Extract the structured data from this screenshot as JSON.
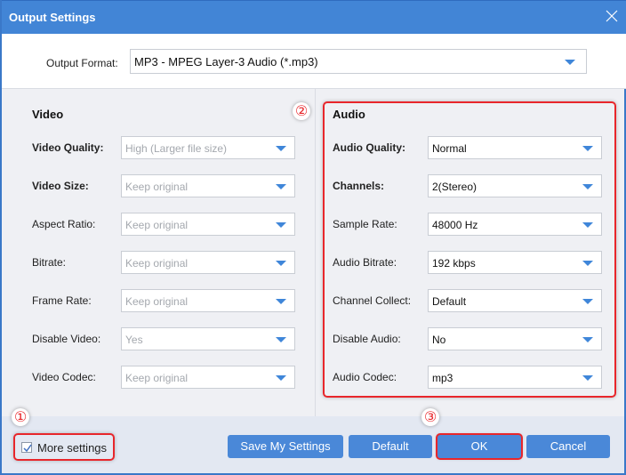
{
  "dialog": {
    "title": "Output Settings",
    "close_icon": "close-icon"
  },
  "output_format": {
    "label": "Output Format:",
    "value": "MP3 - MPEG Layer-3 Audio (*.mp3)"
  },
  "video": {
    "title": "Video",
    "fields": [
      {
        "label": "Video Quality:",
        "value": "High (Larger file size)",
        "bold": true,
        "disabled": true
      },
      {
        "label": "Video Size:",
        "value": "Keep original",
        "bold": true,
        "disabled": true
      },
      {
        "label": "Aspect Ratio:",
        "value": "Keep original",
        "bold": false,
        "disabled": true
      },
      {
        "label": "Bitrate:",
        "value": "Keep original",
        "bold": false,
        "disabled": true
      },
      {
        "label": "Frame Rate:",
        "value": "Keep original",
        "bold": false,
        "disabled": true
      },
      {
        "label": "Disable Video:",
        "value": "Yes",
        "bold": false,
        "disabled": true
      },
      {
        "label": "Video Codec:",
        "value": "Keep original",
        "bold": false,
        "disabled": true
      }
    ]
  },
  "audio": {
    "title": "Audio",
    "fields": [
      {
        "label": "Audio Quality:",
        "value": "Normal",
        "bold": true,
        "disabled": false
      },
      {
        "label": "Channels:",
        "value": "2(Stereo)",
        "bold": true,
        "disabled": false
      },
      {
        "label": "Sample Rate:",
        "value": "48000 Hz",
        "bold": false,
        "disabled": false
      },
      {
        "label": "Audio Bitrate:",
        "value": "192 kbps",
        "bold": false,
        "disabled": false
      },
      {
        "label": "Channel Collect:",
        "value": "Default",
        "bold": false,
        "disabled": false
      },
      {
        "label": "Disable Audio:",
        "value": "No",
        "bold": false,
        "disabled": false
      },
      {
        "label": "Audio Codec:",
        "value": "mp3",
        "bold": false,
        "disabled": false
      }
    ]
  },
  "annotations": {
    "badge_1": "①",
    "badge_2": "②",
    "badge_3": "③",
    "highlight_color": "#e8262b"
  },
  "footer": {
    "more_settings_label": "More settings",
    "more_settings_checked": true,
    "save_label": "Save My Settings",
    "default_label": "Default",
    "ok_label": "OK",
    "cancel_label": "Cancel"
  },
  "colors": {
    "titlebar": "#4285d6",
    "button": "#4a88d8",
    "dropdown_arrow": "#3f86d9",
    "panel_bg": "#eff0f4",
    "footer_bg": "#e3e8f2"
  }
}
